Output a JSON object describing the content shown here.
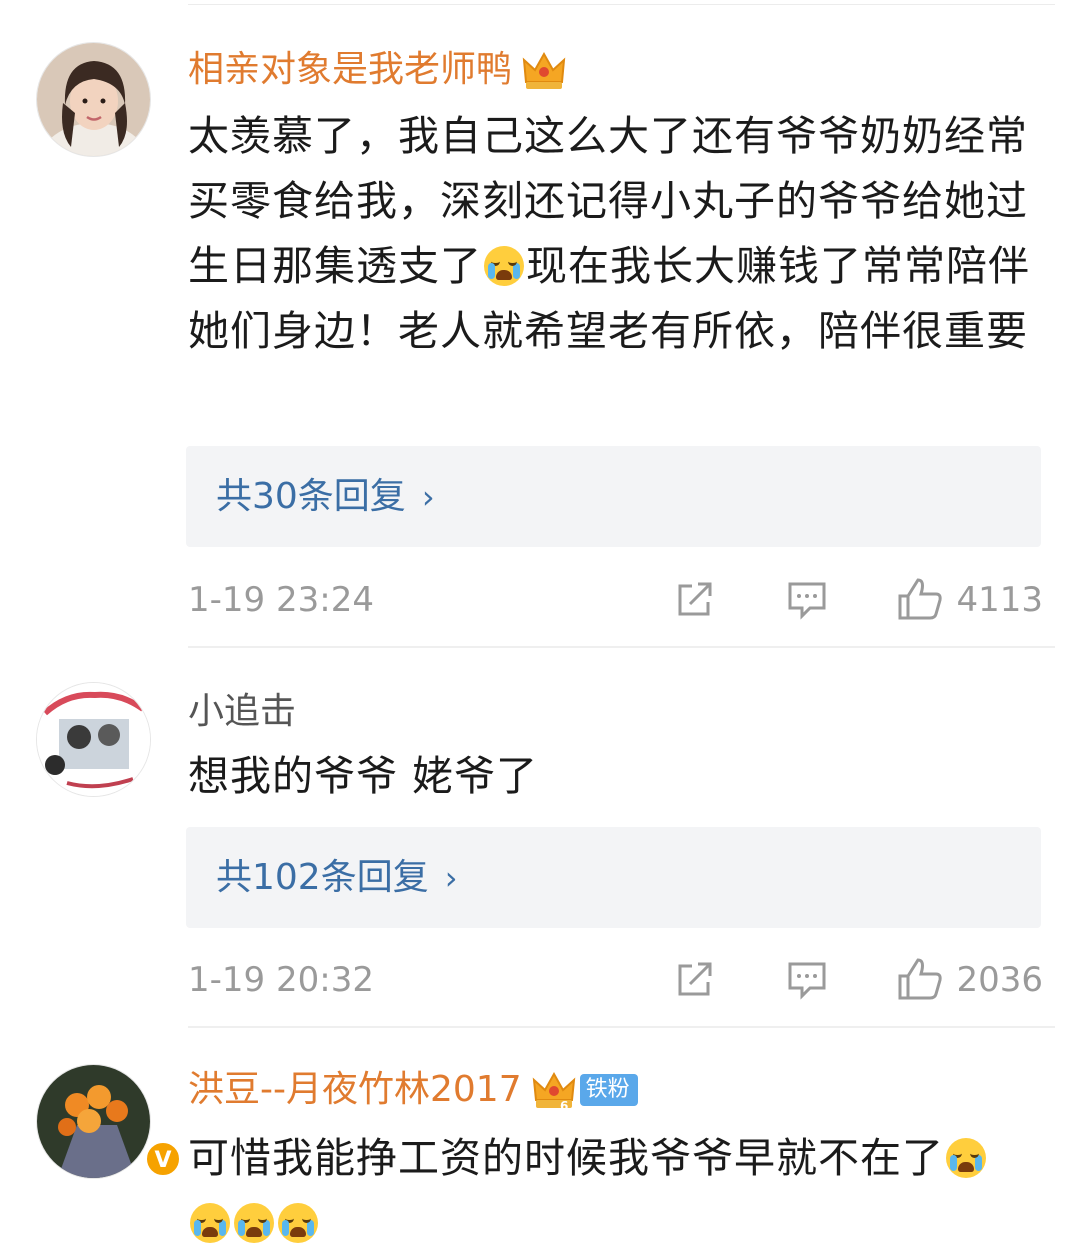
{
  "comments": [
    {
      "username": "相亲对象是我老师鸭",
      "text_parts": [
        "太羡慕了，我自己这么大了还有爷爷奶奶经常买零食给我，深刻还记得小丸子的爷爷给她过生日那集透支了",
        "现在我长大赚钱了常常陪伴她们身边！老人就希望老有所依，陪伴很重要"
      ],
      "replies": "共30条回复",
      "time": "1-19 23:24",
      "likes": "4113"
    },
    {
      "username": "小追击",
      "text": "想我的爷爷 姥爷了",
      "replies": "共102条回复",
      "time": "1-19 20:32",
      "likes": "2036"
    },
    {
      "username": "洪豆--月夜竹林2017",
      "badge": "铁粉",
      "crown_level": "6",
      "text": "可惜我能挣工资的时候我爷爷早就不在了"
    }
  ],
  "icons": {
    "chevron": "›",
    "crown": "crown-icon",
    "share": "share-icon",
    "comment": "comment-icon",
    "like": "like-icon",
    "verified": "V"
  },
  "colors": {
    "vip_name": "#e07b2f",
    "reply_link": "#3b6ea5",
    "meta": "#9a9a9a",
    "fan_badge": "#5aa8ea"
  }
}
